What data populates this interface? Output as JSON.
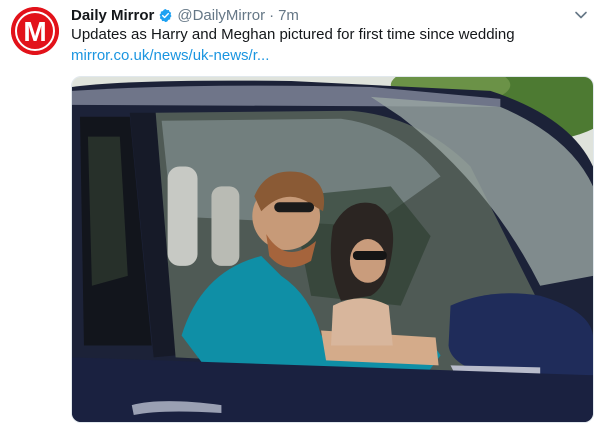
{
  "tweet": {
    "display_name": "Daily Mirror",
    "handle": "@DailyMirror",
    "separator": "·",
    "time": "7m",
    "text": "Updates as Harry and Meghan pictured for first time since wedding",
    "link": "mirror.co.uk/news/uk-news/r...",
    "avatar_letter": "M"
  },
  "icons": {
    "avatar": "daily-mirror-logo",
    "verified": "verified-badge-icon",
    "menu": "chevron-down-icon"
  },
  "colors": {
    "brand_red": "#e2121a",
    "verified_blue": "#1da1f2",
    "link_blue": "#1b95e0",
    "muted_gray": "#657786"
  }
}
